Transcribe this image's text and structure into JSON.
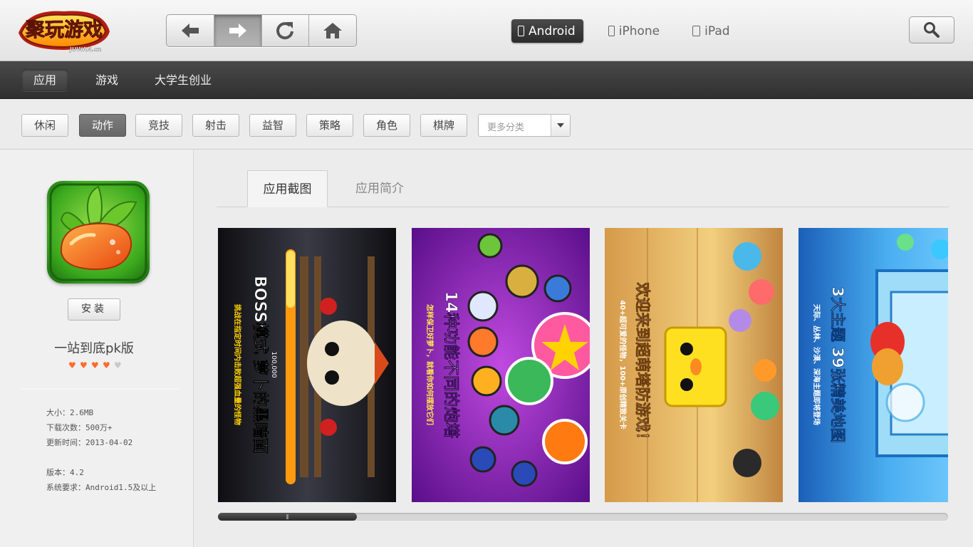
{
  "logo": {
    "text": "聚玩游戏",
    "sub": "JUWAN.cn"
  },
  "platforms": [
    {
      "label": "Android",
      "active": true
    },
    {
      "label": "iPhone",
      "active": false
    },
    {
      "label": "iPad",
      "active": false
    }
  ],
  "categories": [
    {
      "label": "应用",
      "active": true
    },
    {
      "label": "游戏",
      "active": false
    },
    {
      "label": "大学生创业",
      "active": false
    }
  ],
  "subcategories": [
    {
      "label": "休闲",
      "active": false
    },
    {
      "label": "动作",
      "active": true
    },
    {
      "label": "竞技",
      "active": false
    },
    {
      "label": "射击",
      "active": false
    },
    {
      "label": "益智",
      "active": false
    },
    {
      "label": "策略",
      "active": false
    },
    {
      "label": "角色",
      "active": false
    },
    {
      "label": "棋牌",
      "active": false
    }
  ],
  "more_select": {
    "placeholder": "更多分类"
  },
  "app": {
    "name": "一站到底pk版",
    "install_label": "安装",
    "rating": 4,
    "rating_max": 5,
    "size": "大小：2.6MB",
    "downloads": "下载次数：500万+",
    "updated": "更新时间：2013-04-02",
    "version": "版本：4.2",
    "requirement": "系统要求：Android1.5及以上"
  },
  "tabs": [
    {
      "label": "应用截图",
      "active": true
    },
    {
      "label": "应用简介",
      "active": false
    }
  ],
  "screenshots": [
    {
      "title": "BOSS模式 萝卜的黑暗面",
      "subtitle": "挑战在指定时间内击败超强血量的怪物",
      "counter": "100,000"
    },
    {
      "title": "14种功能不同的炮塔",
      "subtitle": "怎样保卫好萝卜，就看你如何摆放它们"
    },
    {
      "title": "欢迎来到超萌塔防游戏！",
      "subtitle": "40+超可爱的怪物，100+原创精致关卡"
    },
    {
      "title": "3大主题 39张精美地图",
      "subtitle": "天际、丛林、沙漠、深海主题即将登场"
    }
  ],
  "scrollbar": {
    "position": 0.19
  },
  "colors": {
    "accent": "#ff6a2a",
    "dark_bar": "#3a3a3a"
  }
}
